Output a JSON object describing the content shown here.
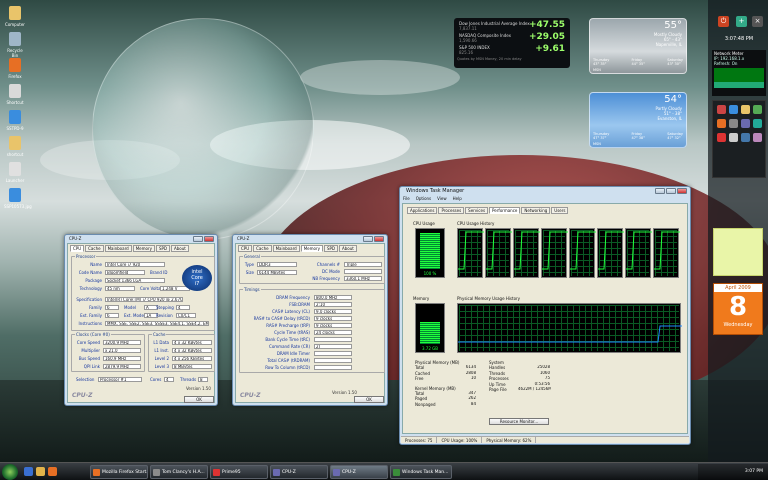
{
  "desktop": {
    "icons": [
      {
        "label": "Computer",
        "color": "#e9c46a"
      },
      {
        "label": "Recycle Bin",
        "color": "#9fb6c8"
      },
      {
        "label": "Firefox",
        "color": "#e76f24"
      },
      {
        "label": "Shortcut",
        "color": "#d9d9d9"
      },
      {
        "label": "SSTPD-9",
        "color": "#3a8dde"
      },
      {
        "label": "shortcut",
        "color": "#e9c46a"
      },
      {
        "label": "Launcher",
        "color": "#e0e0e0"
      },
      {
        "label": "SSP10573.jpg",
        "color": "#3a8dde"
      }
    ]
  },
  "sidebar": {
    "clock": "3:07:48 PM",
    "net_meter": {
      "title": "Network Meter",
      "line1": "IP: 192.168.1.x",
      "line2": "Refresh: On"
    },
    "calendar": {
      "month": "April 2009",
      "day": "8",
      "weekday": "Wednesday"
    }
  },
  "stocks": {
    "rows": [
      {
        "name": "Dow Jones Industrial Average Index",
        "value": "7,837.11",
        "change": "+47.55"
      },
      {
        "name": "NASDAQ Composite Index",
        "value": "1,590.66",
        "change": "+29.05"
      },
      {
        "name": "S&P 500 INDEX",
        "value": "825.16",
        "change": "+9.61"
      }
    ],
    "footer": "Quotes by MSN Money, 20 min delay"
  },
  "weather": [
    {
      "temp": "55°",
      "condition": "Mostly Cloudy",
      "range": "65° - 43°",
      "city": "Naperville, IL",
      "days": [
        {
          "d": "Thursday",
          "t": "43° 35°"
        },
        {
          "d": "Friday",
          "t": "44° 35°"
        },
        {
          "d": "Saturday",
          "t": "43° 30°"
        }
      ],
      "source": "MSN"
    },
    {
      "temp": "54°",
      "condition": "Partly Cloudy",
      "range": "51° - 38°",
      "city": "Evanston, IL",
      "days": [
        {
          "d": "Thursday",
          "t": "47° 37°"
        },
        {
          "d": "Friday",
          "t": "47° 38°"
        },
        {
          "d": "Saturday",
          "t": "47° 32°"
        }
      ],
      "source": "MSN"
    }
  ],
  "cpuz1": {
    "title": "CPU-Z",
    "tabs": [
      "CPU",
      "Cache",
      "Mainboard",
      "Memory",
      "SPD",
      "About"
    ],
    "processor_label": "Processor",
    "fields": [
      {
        "k": "Name",
        "v": "Intel Core i7 920"
      },
      {
        "k": "Code Name",
        "v": "Bloomfield"
      },
      {
        "k": "Package",
        "v": "Socket 1366 LGA"
      },
      {
        "k": "Technology",
        "v": "45 nm"
      },
      {
        "k": "Specification",
        "v": "Intel(R) Core(TM) i7 CPU  920 @ 2.67GHz"
      },
      {
        "k": "Family",
        "v": "6"
      },
      {
        "k": "Ext. Family",
        "v": "6"
      },
      {
        "k": "Instructions",
        "v": "MMX, SSE, SSE2, SSE3, SSSE3, SSE4.1, SSE4.2, EM64T"
      }
    ],
    "extras": {
      "brand_id": "Brand ID",
      "core_voltage_k": "Core Voltage",
      "core_voltage": "1.248 V",
      "model_k": "Model",
      "model": "A",
      "stepping_k": "Stepping",
      "stepping": "4",
      "ext_model_k": "Ext. Model",
      "ext_model": "1A",
      "revision_k": "Revision",
      "revision": "C0/C1"
    },
    "clocks_label": "Clocks (Core #0)",
    "clocks": [
      {
        "k": "Core Speed",
        "v": "3200.9 MHz"
      },
      {
        "k": "Multiplier",
        "v": "x 21.0"
      },
      {
        "k": "Bus Speed",
        "v": "160.9 MHz"
      },
      {
        "k": "QPI Link",
        "v": "2879.9 MHz"
      }
    ],
    "cache_label": "Cache",
    "cache": [
      {
        "k": "L1 Data",
        "v": "4 x 32 KBytes"
      },
      {
        "k": "L1 Inst.",
        "v": "4 x 32 KBytes"
      },
      {
        "k": "Level 2",
        "v": "4 x 256 KBytes"
      },
      {
        "k": "Level 3",
        "v": "8 MBytes"
      }
    ],
    "selection_k": "Selection",
    "selection": "Processor #1",
    "cores_k": "Cores",
    "cores": "4",
    "threads_k": "Threads",
    "threads": "8",
    "version": "Version 1.50",
    "ok": "OK",
    "brand": "CPU-Z",
    "intel_badge": {
      "line1": "intel",
      "line2": "Core",
      "line3": "i7"
    }
  },
  "cpuz2": {
    "title": "CPU-Z",
    "tabs": [
      "CPU",
      "Cache",
      "Mainboard",
      "Memory",
      "SPD",
      "About"
    ],
    "general_label": "General",
    "general": [
      {
        "k": "Type",
        "v": "DDR3"
      },
      {
        "k": "Size",
        "v": "6144 MBytes"
      },
      {
        "k": "Channels #",
        "v": "Triple"
      },
      {
        "k": "DC Mode",
        "v": ""
      },
      {
        "k": "NB Frequency",
        "v": "3360.1 MHz"
      }
    ],
    "timings_label": "Timings",
    "timings": [
      {
        "k": "DRAM Frequency",
        "v": "800.0 MHz"
      },
      {
        "k": "FSB:DRAM",
        "v": "2:10"
      },
      {
        "k": "CAS# Latency (CL)",
        "v": "9.0 clocks"
      },
      {
        "k": "RAS# to CAS# Delay (tRCD)",
        "v": "9 clocks"
      },
      {
        "k": "RAS# Precharge (tRP)",
        "v": "9 clocks"
      },
      {
        "k": "Cycle Time (tRAS)",
        "v": "24 clocks"
      },
      {
        "k": "Bank Cycle Time (tRC)",
        "v": ""
      },
      {
        "k": "Command Rate (CR)",
        "v": "2T"
      },
      {
        "k": "DRAM Idle Timer",
        "v": ""
      },
      {
        "k": "Total CAS# (tRDRAM)",
        "v": ""
      },
      {
        "k": "Row To Column (tRCD)",
        "v": ""
      }
    ],
    "version": "Version 1.50",
    "ok": "OK",
    "brand": "CPU-Z"
  },
  "taskmgr": {
    "title": "Windows Task Manager",
    "menu": [
      "File",
      "Options",
      "View",
      "Help"
    ],
    "tabs": [
      "Applications",
      "Processes",
      "Services",
      "Performance",
      "Networking",
      "Users"
    ],
    "cpu_usage_label": "CPU Usage",
    "cpu_usage_value": "100 %",
    "cpu_usage_level": 1.0,
    "cpu_history_label": "CPU Usage History",
    "mem_label": "Memory",
    "mem_value": "3.72 GB",
    "mem_level": 0.62,
    "mem_history_label": "Physical Memory Usage History",
    "phys_label": "Physical Memory (MB)",
    "phys": [
      {
        "k": "Total",
        "v": "6134"
      },
      {
        "k": "Cached",
        "v": "2808"
      },
      {
        "k": "Free",
        "v": "10"
      }
    ],
    "kernel_label": "Kernel Memory (MB)",
    "kernel": [
      {
        "k": "Total",
        "v": "347"
      },
      {
        "k": "Paged",
        "v": "262"
      },
      {
        "k": "Nonpaged",
        "v": "84"
      }
    ],
    "system_label": "System",
    "system": [
      {
        "k": "Handles",
        "v": "25028"
      },
      {
        "k": "Threads",
        "v": "1060"
      },
      {
        "k": "Processes",
        "v": "75"
      },
      {
        "k": "Up Time",
        "v": "0:53:56"
      },
      {
        "k": "Page File",
        "v": "4622M / 12456M"
      }
    ],
    "resource_button": "Resource Monitor...",
    "status": {
      "processes": "Processes: 75",
      "cpu": "CPU Usage: 100%",
      "mem": "Physical Memory: 62%"
    }
  },
  "taskbar": {
    "buttons": [
      {
        "label": "Mozilla Firefox Start...",
        "color": "#e76f24"
      },
      {
        "label": "Tom Clancy's H.A...",
        "color": "#8b8b8b"
      },
      {
        "label": "Prime95",
        "color": "#d33"
      },
      {
        "label": "CPU-Z",
        "color": "#6a6ab0"
      },
      {
        "label": "CPU-Z",
        "color": "#6a6ab0"
      },
      {
        "label": "Windows Task Man...",
        "color": "#3a8d3a"
      }
    ],
    "time": "3:07 PM"
  }
}
